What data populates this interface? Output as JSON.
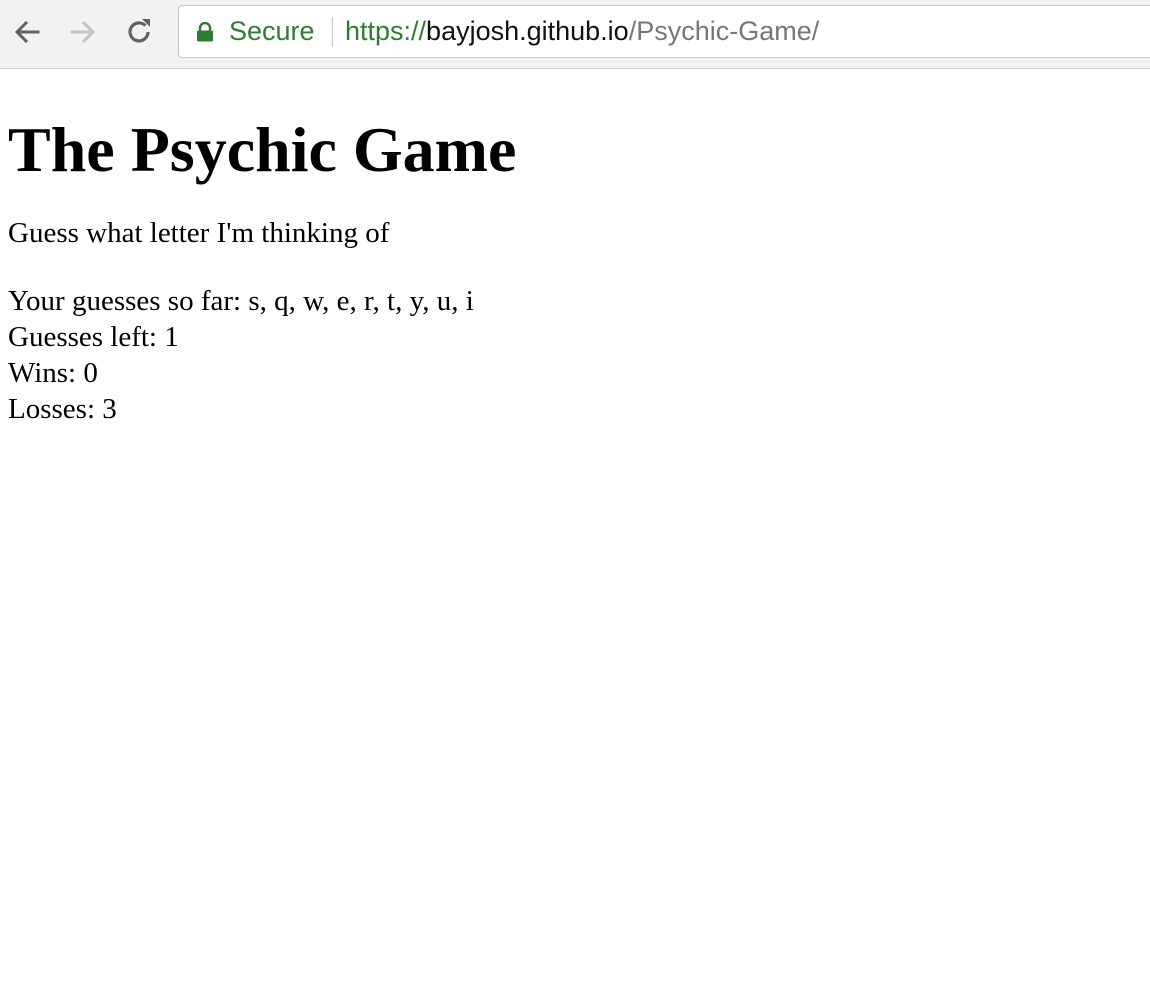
{
  "browser": {
    "secure_label": "Secure",
    "url_scheme": "https://",
    "url_host": "bayjosh.github.io",
    "url_path": "/Psychic-Game/",
    "icons": {
      "back": "arrow-left-icon",
      "forward": "arrow-right-icon",
      "reload": "reload-icon",
      "lock": "lock-icon"
    },
    "colors": {
      "secure_green": "#2e7d32",
      "path_gray": "#777777"
    }
  },
  "page": {
    "title": "The Psychic Game",
    "intro": "Guess what letter I'm thinking of",
    "guesses_so_far_label": "Your guesses so far: ",
    "guesses_so_far": "s, q, w, e, r, t, y, u, i",
    "guesses_left_label": "Guesses left: ",
    "guesses_left": "1",
    "wins_label": "Wins: ",
    "wins": "0",
    "losses_label": "Losses: ",
    "losses": "3"
  }
}
